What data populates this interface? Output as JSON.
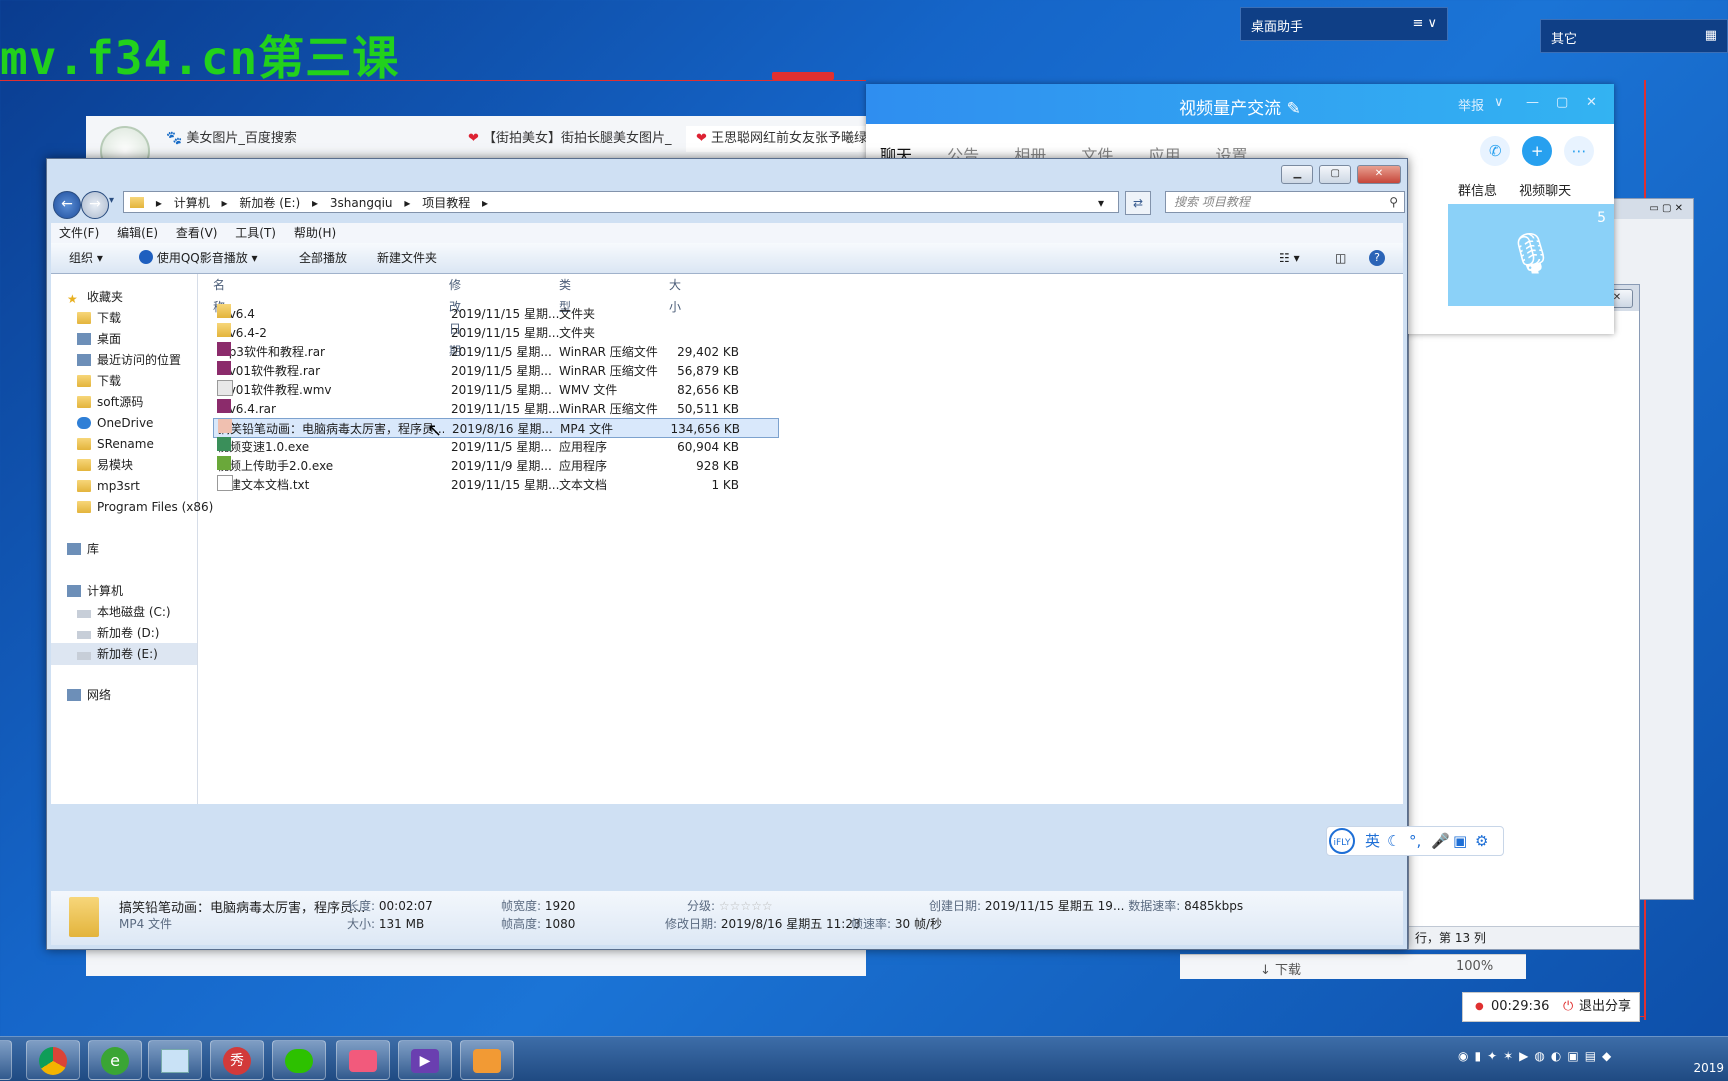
{
  "desktop": {
    "watermark": "mv.f34.cn第三课",
    "helper_title": "桌面助手",
    "helper_menu": "≡ ∨",
    "other_title": "其它"
  },
  "chat": {
    "title": "视频量产交流",
    "report": "举报",
    "tabs": [
      "聊天",
      "公告",
      "相册",
      "文件",
      "应用",
      "设置"
    ],
    "side_tabs": [
      "群信息",
      "视频聊天"
    ],
    "member_count": "5"
  },
  "browser": {
    "tabs": [
      "美女图片_百度搜索",
      "【街拍美女】街拍长腿美女图片_",
      "王思聪网红前女友张予曦绿洲帅"
    ],
    "status_download": "下载",
    "zoom": "100%"
  },
  "bg_window": {
    "status": "行，第 13 列"
  },
  "explorer": {
    "address": [
      "计算机",
      "新加卷 (E:)",
      "3shangqiu",
      "项目教程"
    ],
    "search_placeholder": "搜索 项目教程",
    "menu": [
      "文件(F)",
      "编辑(E)",
      "查看(V)",
      "工具(T)",
      "帮助(H)"
    ],
    "toolbar": {
      "organize": "组织",
      "play_qq": "使用QQ影音播放",
      "play_all": "全部播放",
      "new_folder": "新建文件夹"
    },
    "nav": [
      {
        "label": "收藏夹"
      },
      {
        "label": "下载"
      },
      {
        "label": "桌面"
      },
      {
        "label": "最近访问的位置"
      },
      {
        "label": "下载"
      },
      {
        "label": "soft源码"
      },
      {
        "label": "OneDrive"
      },
      {
        "label": "SRename"
      },
      {
        "label": "易模块"
      },
      {
        "label": "mp3srt"
      },
      {
        "label": "Program Files (x86)"
      },
      {
        "label": "库"
      },
      {
        "label": "计算机"
      },
      {
        "label": "本地磁盘 (C:)"
      },
      {
        "label": "新加卷 (D:)"
      },
      {
        "label": "新加卷 (E:)"
      },
      {
        "label": "网络"
      }
    ],
    "columns": [
      "名称",
      "修改日期",
      "类型",
      "大小"
    ],
    "files": [
      {
        "name": "mv6.4",
        "date": "2019/11/15 星期...",
        "type": "文件夹",
        "size": ""
      },
      {
        "name": "mv6.4-2",
        "date": "2019/11/15 星期...",
        "type": "文件夹",
        "size": ""
      },
      {
        "name": "mp3软件和教程.rar",
        "date": "2019/11/5 星期...",
        "type": "WinRAR 压缩文件",
        "size": "29,402 KB"
      },
      {
        "name": "mv01软件教程.rar",
        "date": "2019/11/5 星期...",
        "type": "WinRAR 压缩文件",
        "size": "56,879 KB"
      },
      {
        "name": "mv01软件教程.wmv",
        "date": "2019/11/5 星期...",
        "type": "WMV 文件",
        "size": "82,656 KB"
      },
      {
        "name": "mv6.4.rar",
        "date": "2019/11/15 星期...",
        "type": "WinRAR 压缩文件",
        "size": "50,511 KB"
      },
      {
        "name": "搞笑铅笔动画：电脑病毒太厉害，程序员...",
        "date": "2019/8/16 星期...",
        "type": "MP4 文件",
        "size": "134,656 KB"
      },
      {
        "name": "视频变速1.0.exe",
        "date": "2019/11/5 星期...",
        "type": "应用程序",
        "size": "60,904 KB"
      },
      {
        "name": "视频上传助手2.0.exe",
        "date": "2019/11/9 星期...",
        "type": "应用程序",
        "size": "928 KB"
      },
      {
        "name": "新建文本文档.txt",
        "date": "2019/11/15 星期...",
        "type": "文本文档",
        "size": "1 KB"
      }
    ],
    "details": {
      "name": "搞笑铅笔动画：电脑病毒太厉害，程序员...",
      "filetype": "MP4 文件",
      "length_label": "长度:",
      "length": "00:02:07",
      "size_label": "大小:",
      "size": "131 MB",
      "width_label": "帧宽度:",
      "width": "1920",
      "height_label": "帧高度:",
      "height": "1080",
      "rating_label": "分级:",
      "modified_label": "修改日期:",
      "modified": "2019/8/16 星期五 11:23",
      "created_label": "创建日期:",
      "created": "2019/11/15 星期五 19...",
      "datarate_label": "数据速率:",
      "datarate": "8485kbps",
      "framerate_label": "帧速率:",
      "framerate": "30 帧/秒"
    }
  },
  "ifly": {
    "logo": "iFLY",
    "lang": "英"
  },
  "share": {
    "timer": "00:29:36",
    "exit": "退出分享"
  },
  "tray": {
    "date": "2019"
  },
  "taskbar_apps": [
    "chrome-icon",
    "ie-icon",
    "notepad-icon",
    "xiu-icon",
    "wechat-icon",
    "video-chat-icon",
    "video-editor-icon",
    "toolbox-icon"
  ],
  "taskbar_labels": {
    "xiu": "秀"
  }
}
